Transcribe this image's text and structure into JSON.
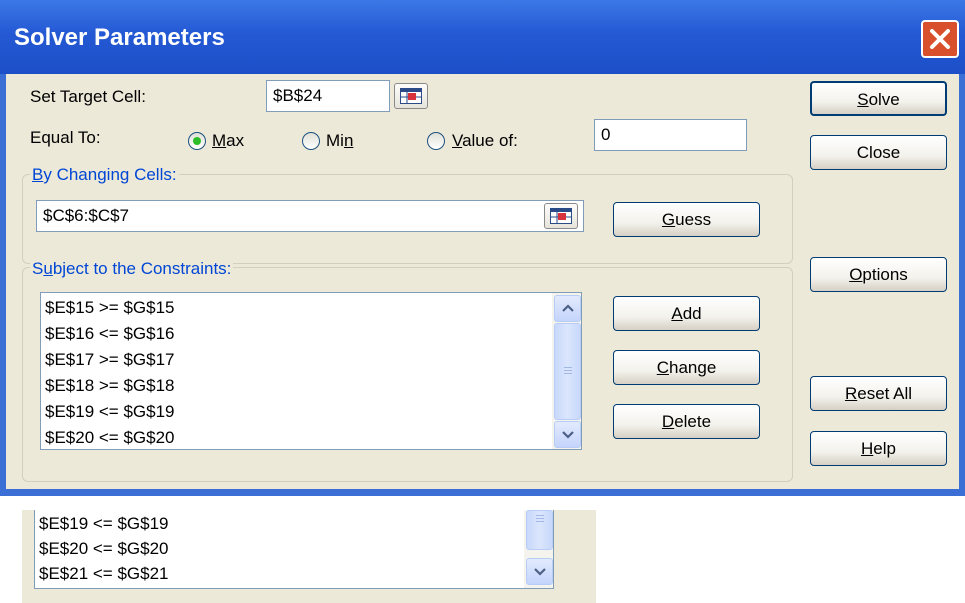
{
  "dialog": {
    "title": "Solver Parameters",
    "close_glyph": "✕"
  },
  "target": {
    "label": "Set Target Cell:",
    "value": "$B$24"
  },
  "equal_to": {
    "label": "Equal To:",
    "options": [
      {
        "key": "M",
        "rest": "ax",
        "selected": true
      },
      {
        "prefix": "Mi",
        "key": "n",
        "selected": false
      },
      {
        "key": "V",
        "rest": "alue of:",
        "selected": false
      }
    ],
    "value_of": "0"
  },
  "changing": {
    "label_pre": "",
    "label_key": "B",
    "label_rest": "y Changing Cells:",
    "value": "$C$6:$C$7"
  },
  "constraints": {
    "label_pre": "S",
    "label_key": "u",
    "label_rest": "bject to the Constraints:",
    "items": [
      "$E$15 >= $G$15",
      "$E$16 <= $G$16",
      "$E$17 >= $G$17",
      "$E$18 >= $G$18",
      "$E$19 <= $G$19",
      "$E$20 <= $G$20"
    ]
  },
  "buttons": {
    "solve": {
      "key": "S",
      "rest": "olve"
    },
    "close": "Close",
    "guess": {
      "key": "G",
      "rest": "uess"
    },
    "options": {
      "key": "O",
      "rest": "ptions"
    },
    "add": {
      "key": "A",
      "rest": "dd"
    },
    "change": {
      "key": "C",
      "rest": "hange"
    },
    "delete": {
      "key": "D",
      "rest": "elete"
    },
    "reset_all": {
      "key": "R",
      "rest": "eset All"
    },
    "help": {
      "key": "H",
      "rest": "elp"
    }
  },
  "fragment": {
    "items": [
      "$E$19 <= $G$19",
      "$E$20 <= $G$20",
      "$E$21 <= $G$21"
    ]
  },
  "icons": {
    "close": "close-icon",
    "ref": "range-select-icon",
    "scroll_up": "chevron-up-icon",
    "scroll_down": "chevron-down-icon"
  }
}
